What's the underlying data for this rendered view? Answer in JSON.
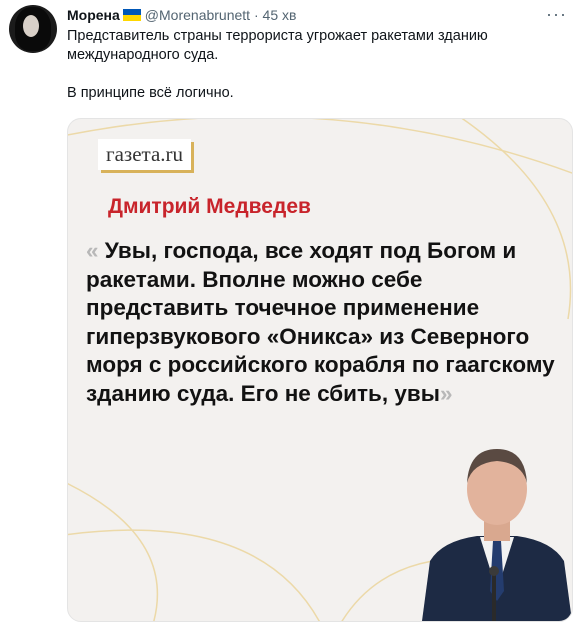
{
  "author": {
    "name": "Морена",
    "handle": "@Morenabrunett",
    "separator": "·",
    "time": "45 хв",
    "flag_colors": [
      "#0057b7",
      "#ffd700"
    ]
  },
  "menu_glyph": "···",
  "tweet_text": {
    "line1": "Представитель страны террориста угрожает ракетами зданию",
    "line2": "международного суда.",
    "line3": "В принципе всё логично."
  },
  "media": {
    "logo": "газета.ru",
    "speaker": "Дмитрий Медведев",
    "open_quote": "«",
    "quote": "Увы, господа, все ходят под Богом и ракетами. Вполне можно себе представить точечное применение гиперзвукового «Оникса» из Северного моря с российского корабля по гаагскому зданию суда. Его не сбить, увы",
    "close_quote": "»",
    "accent_color": "#c8242b",
    "gold_color": "#d8b25a"
  }
}
